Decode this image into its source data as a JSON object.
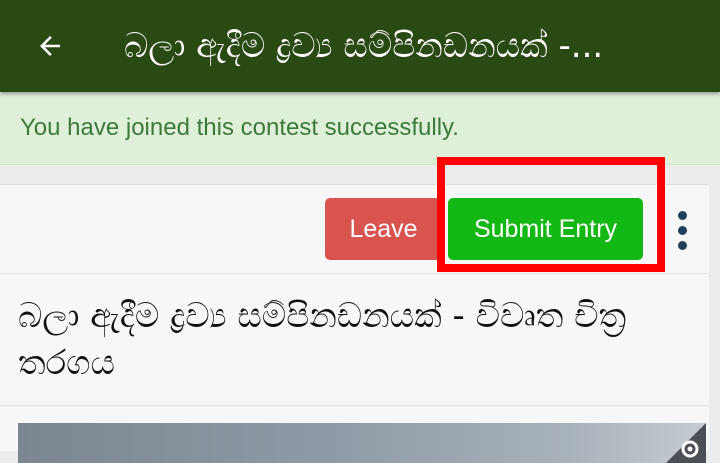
{
  "appbar": {
    "title": "බලා ඇදීම ද්‍රව්‍ය සම්පිනඩනයක් -...",
    "back_icon": "arrow-left-icon",
    "background": "#2a4a13"
  },
  "alert": {
    "message": "You have joined this contest successfully.",
    "background": "#dff0d8",
    "text_color": "#3c7a3c"
  },
  "actions": {
    "leave_label": "Leave",
    "submit_label": "Submit Entry",
    "more_icon": "more-vertical-icon",
    "leave_color": "#d9534f",
    "submit_color": "#14b814"
  },
  "post": {
    "title": "බලා ඇදීම ද්‍රව්‍ය සම්පිනඩනයක් - විවෘත චිත්‍ර තරගය"
  },
  "annotation": {
    "highlight_color": "#ff0000"
  }
}
